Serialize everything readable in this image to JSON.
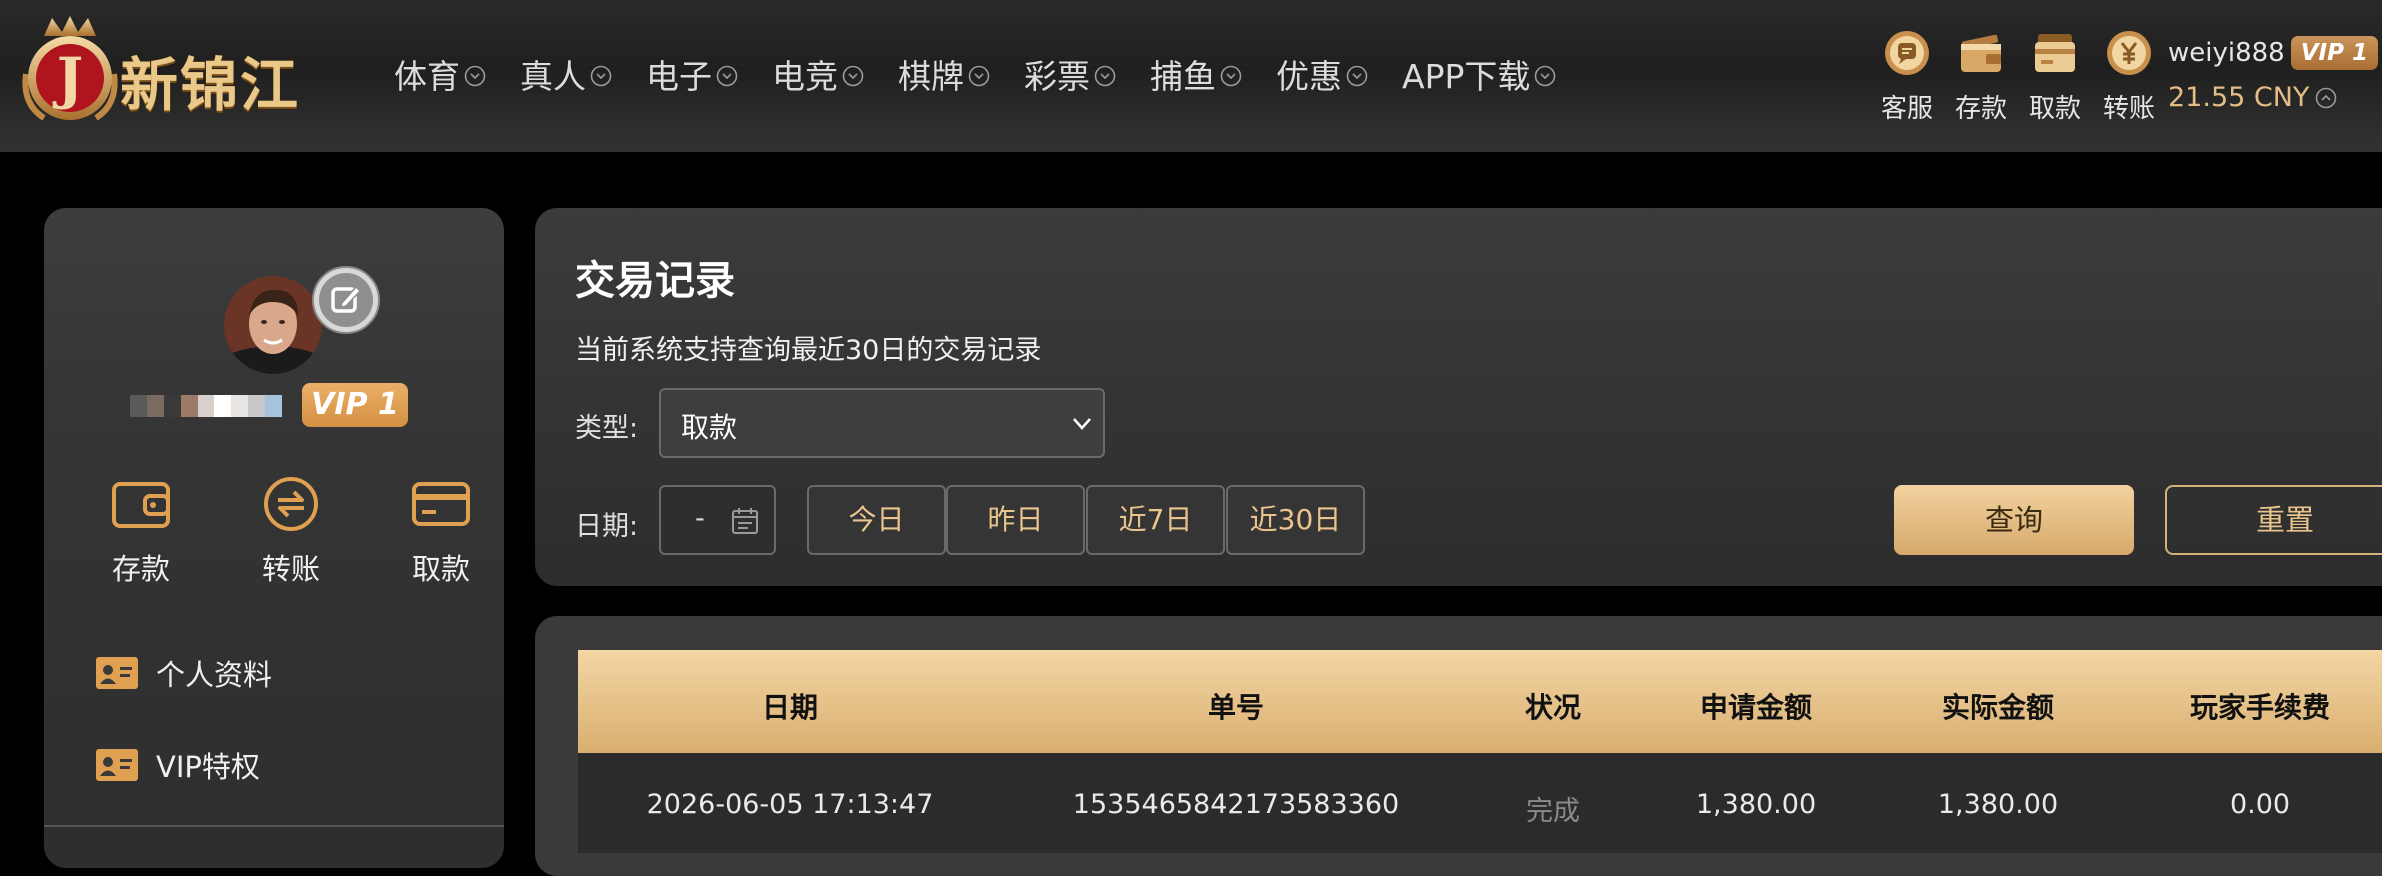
{
  "brand": {
    "name": "新锦江",
    "emblem_letter": "J"
  },
  "nav": [
    {
      "label": "体育"
    },
    {
      "label": "真人"
    },
    {
      "label": "电子"
    },
    {
      "label": "电竞"
    },
    {
      "label": "棋牌"
    },
    {
      "label": "彩票"
    },
    {
      "label": "捕鱼"
    },
    {
      "label": "优惠"
    },
    {
      "label": "APP下载"
    }
  ],
  "top_actions": [
    {
      "label": "客服",
      "icon": "chat-icon"
    },
    {
      "label": "存款",
      "icon": "wallet-icon"
    },
    {
      "label": "取款",
      "icon": "card-icon"
    },
    {
      "label": "转账",
      "icon": "yuan-coin-icon"
    }
  ],
  "user": {
    "username": "weiyi888",
    "vip": "VIP 1",
    "balance": "21.55 CNY"
  },
  "sidebar": {
    "vip": "VIP 1",
    "wallet_actions": [
      {
        "label": "存款",
        "icon": "wallet-icon"
      },
      {
        "label": "转账",
        "icon": "transfer-icon"
      },
      {
        "label": "取款",
        "icon": "card-icon"
      }
    ],
    "menu": [
      {
        "label": "个人资料",
        "icon": "id-card-icon"
      },
      {
        "label": "VIP特权",
        "icon": "vip-card-icon"
      }
    ]
  },
  "filter": {
    "title": "交易记录",
    "description": "当前系统支持查询最近30日的交易记录",
    "type_label": "类型:",
    "type_value": "取款",
    "date_label": "日期:",
    "date_value": "-",
    "quick_ranges": [
      "今日",
      "昨日",
      "近7日",
      "近30日"
    ],
    "query_label": "查询",
    "reset_label": "重置"
  },
  "table": {
    "headers": [
      "日期",
      "单号",
      "状况",
      "申请金额",
      "实际金额",
      "玩家手续费"
    ],
    "rows": [
      [
        "2026-06-05 17:13:47",
        "1535465842173583360",
        "完成",
        "1,380.00",
        "1,380.00",
        "0.00"
      ]
    ]
  },
  "colors": {
    "gold": "#e9c48d",
    "gold_dark": "#d6a96b",
    "vip_orange": "#e0a052",
    "panel": "#353535"
  }
}
